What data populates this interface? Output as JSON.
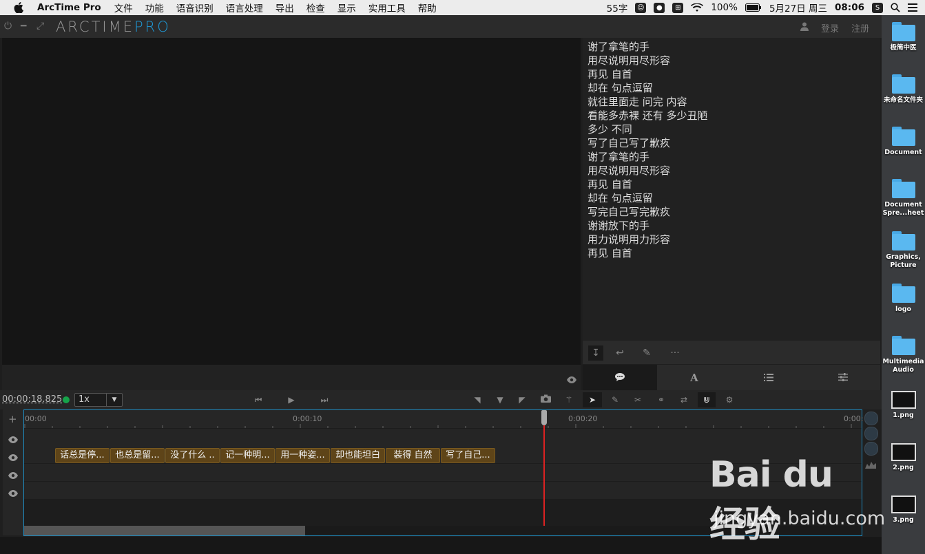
{
  "menubar": {
    "app_name": "ArcTime Pro",
    "items": [
      "文件",
      "功能",
      "语音识别",
      "语言处理",
      "导出",
      "检查",
      "显示",
      "实用工具",
      "帮助"
    ],
    "status": {
      "char_count": "55字",
      "battery": "100%",
      "date": "5月27日 周三",
      "time": "08:06"
    }
  },
  "app": {
    "logo_main": "ARCTIME",
    "logo_accent": "PRO",
    "login": "登录",
    "register": "注册"
  },
  "script_lines": [
    "谢了拿笔的手",
    "用尽说明用尽形容",
    "再见 自首",
    "却在 句点逗留",
    "就往里面走 问完 内容",
    "看能多赤裸 还有 多少丑陋",
    "多少 不同",
    "写了自己写了歉疚",
    "谢了拿笔的手",
    "用尽说明用尽形容",
    "再见 自首",
    "却在 句点逗留",
    "写完自己写完歉疚",
    "谢谢放下的手",
    "用力说明用力形容",
    "再见 自首"
  ],
  "transport": {
    "timecode": "00:00:18.825",
    "speed": "1x"
  },
  "timeline": {
    "ruler_labels": [
      "00:00",
      "0:00:10",
      "0:00:20",
      "0:00:"
    ],
    "subtitles": [
      "话总是停...",
      "也总是留...",
      "没了什么 ..",
      "记一种明...",
      "用一种姿...",
      "却也能坦白",
      "装得 自然",
      "写了自己..."
    ]
  },
  "desktop": {
    "items": [
      "极简中医",
      "未命名文件夹",
      "Document",
      "Document Spre...heet",
      "Graphics, Picture",
      "logo",
      "Multimedia Audio",
      "1.png",
      "2.png",
      "3.png"
    ]
  },
  "watermark": {
    "brand": "Bai du 经验",
    "url": "jingyan.baidu.com"
  }
}
